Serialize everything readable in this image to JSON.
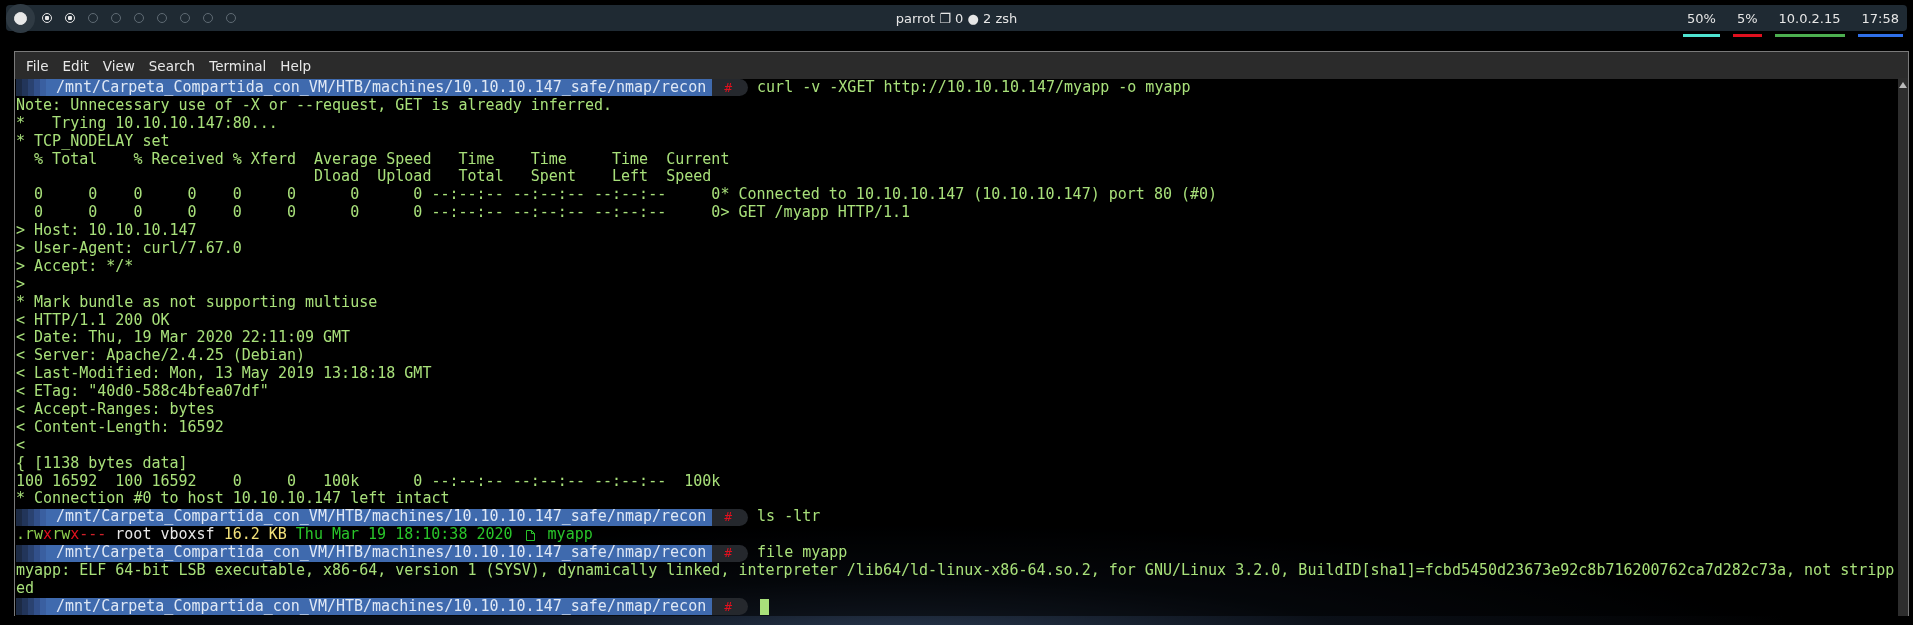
{
  "top_bar": {
    "workspaces": [
      {
        "selected": true,
        "occupied": true
      },
      {
        "selected": false,
        "occupied": true
      },
      {
        "selected": false,
        "occupied": true
      },
      {
        "selected": false,
        "occupied": false
      },
      {
        "selected": false,
        "occupied": false
      },
      {
        "selected": false,
        "occupied": false
      },
      {
        "selected": false,
        "occupied": false
      },
      {
        "selected": false,
        "occupied": false
      },
      {
        "selected": false,
        "occupied": false
      },
      {
        "selected": false,
        "occupied": false
      }
    ],
    "title": "parrot ❐ 0 ● 2 zsh",
    "indicators": [
      {
        "text": "50%",
        "color": "#4fe3d0"
      },
      {
        "text": "5%",
        "color": "#e0101e"
      },
      {
        "text": "10.0.2.15",
        "color": "#4caf50"
      },
      {
        "text": "17:58",
        "color": "#2f6fe8"
      }
    ]
  },
  "terminal": {
    "menu": [
      "File",
      "Edit",
      "View",
      "Search",
      "Terminal",
      "Help"
    ],
    "lines": [
      {
        "kind": "prompt",
        "path": "/mnt/Carpeta_Compartida_con_VM/HTB/machines/10.10.10.147_safe/nmap/recon",
        "symbol": "#",
        "command": "curl -v -XGET http://10.10.10.147/myapp -o myapp",
        "cursor": false
      },
      {
        "kind": "text",
        "text": "Note: Unnecessary use of -X or --request, GET is already inferred."
      },
      {
        "kind": "text",
        "text": "*   Trying 10.10.10.147:80..."
      },
      {
        "kind": "text",
        "text": "* TCP_NODELAY set"
      },
      {
        "kind": "text",
        "text": "  % Total    % Received % Xferd  Average Speed   Time    Time     Time  Current"
      },
      {
        "kind": "text",
        "text": "                                 Dload  Upload   Total   Spent    Left  Speed"
      },
      {
        "kind": "text",
        "text": "  0     0    0     0    0     0      0      0 --:--:-- --:--:-- --:--:--     0* Connected to 10.10.10.147 (10.10.10.147) port 80 (#0)"
      },
      {
        "kind": "text",
        "text": "  0     0    0     0    0     0      0      0 --:--:-- --:--:-- --:--:--     0> GET /myapp HTTP/1.1"
      },
      {
        "kind": "text",
        "text": "> Host: 10.10.10.147"
      },
      {
        "kind": "text",
        "text": "> User-Agent: curl/7.67.0"
      },
      {
        "kind": "text",
        "text": "> Accept: */*"
      },
      {
        "kind": "text",
        "text": ">"
      },
      {
        "kind": "text",
        "text": "* Mark bundle as not supporting multiuse"
      },
      {
        "kind": "text",
        "text": "< HTTP/1.1 200 OK"
      },
      {
        "kind": "text",
        "text": "< Date: Thu, 19 Mar 2020 22:11:09 GMT"
      },
      {
        "kind": "text",
        "text": "< Server: Apache/2.4.25 (Debian)"
      },
      {
        "kind": "text",
        "text": "< Last-Modified: Mon, 13 May 2019 13:18:18 GMT"
      },
      {
        "kind": "text",
        "text": "< ETag: \"40d0-588c4bfea07df\""
      },
      {
        "kind": "text",
        "text": "< Accept-Ranges: bytes"
      },
      {
        "kind": "text",
        "text": "< Content-Length: 16592"
      },
      {
        "kind": "text",
        "text": "<"
      },
      {
        "kind": "text",
        "text": "{ [1138 bytes data]"
      },
      {
        "kind": "text",
        "text": "100 16592  100 16592    0     0   100k      0 --:--:-- --:--:-- --:--:--  100k"
      },
      {
        "kind": "text",
        "text": "* Connection #0 to host 10.10.10.147 left intact"
      },
      {
        "kind": "prompt",
        "path": "/mnt/Carpeta_Compartida_con_VM/HTB/machines/10.10.10.147_safe/nmap/recon",
        "symbol": "#",
        "command": "ls -ltr",
        "cursor": false
      },
      {
        "kind": "listing",
        "permissions": [
          {
            "text": ".rw",
            "kind": "readwrite"
          },
          {
            "text": "x",
            "kind": "execute"
          },
          {
            "text": "rw",
            "kind": "readwrite"
          },
          {
            "text": "x",
            "kind": "execute"
          },
          {
            "text": "---",
            "kind": "none"
          }
        ],
        "owner": "root",
        "group": "vboxsf",
        "size": "16.2 KB",
        "date": "Thu Mar 19 18:10:38 2020",
        "name": "myapp"
      },
      {
        "kind": "prompt",
        "path": "/mnt/Carpeta_Compartida_con_VM/HTB/machines/10.10.10.147_safe/nmap/recon",
        "symbol": "#",
        "command": "file myapp",
        "cursor": false
      },
      {
        "kind": "text",
        "text": "myapp: ELF 64-bit LSB executable, x86-64, version 1 (SYSV), dynamically linked, interpreter /lib64/ld-linux-x86-64.so.2, for GNU/Linux 3.2.0, BuildID[sha1]=fcbd5450d23673e92c8b716200762ca7d282c73a, not stripp"
      },
      {
        "kind": "text",
        "text": "ed"
      },
      {
        "kind": "prompt",
        "path": "/mnt/Carpeta_Compartida_con_VM/HTB/machines/10.10.10.147_safe/nmap/recon",
        "symbol": "#",
        "cursor": true
      }
    ]
  }
}
